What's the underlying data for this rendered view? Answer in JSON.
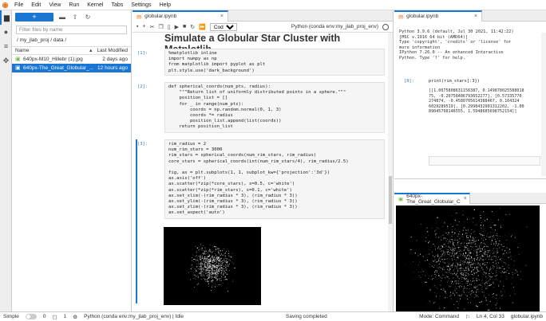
{
  "menubar": {
    "items": [
      "File",
      "Edit",
      "View",
      "Run",
      "Kernel",
      "Tabs",
      "Settings",
      "Help"
    ]
  },
  "leftbar": {
    "icons": [
      "folder-icon",
      "running-icon",
      "commands-icon",
      "extension-icon"
    ]
  },
  "filebrowser": {
    "new_label": "+",
    "filter_placeholder": "Filter files by name",
    "breadcrumb": "/ my_jlab_proj / data /",
    "col_name": "Name",
    "col_modified": "Last Modified",
    "sort_indicator": "▴",
    "files": [
      {
        "name": "640px-M10_Hillebr (1).jpg",
        "modified": "2 days ago"
      },
      {
        "name": "640px-The_Great_Globular_...",
        "modified": "12 hours ago"
      }
    ]
  },
  "notebook": {
    "tab_label": "globular.ipynb",
    "celltype": "Code",
    "kernel": "Python (conda env:my_jlab_proj_env)",
    "title": "Simulate a Globular Star Cluster with Matplotlib",
    "cells": [
      {
        "prompt": "[1]:",
        "code": "%matplotlib inline\nimport numpy as np\nfrom matplotlib import pyplot as plt\nplt.style.use('dark_background')"
      },
      {
        "prompt": "[2]:",
        "code": "def spherical_coords(num_pts, radius):\n    \"\"\"Return list of uniformly distributed points in a sphere.\"\"\"\n    position_list = []\n    for _ in range(num_pts):\n        coords = np.random.normal(0, 1, 3)\n        coords *= radius\n        position_list.append(list(coords))\n    return position_list"
      },
      {
        "prompt": "[3]:",
        "code": "rim_radius = 2\nnum_rim_stars = 3000\nrim_stars = spherical_coords(num_rim_stars, rim_radius)\ncore_stars = spherical_coords(int(num_rim_stars/4), rim_radius/2.5)\n\nfig, ax = plt.subplots(1, 1, subplot_kw={'projection':'3d'})\nax.axis('off')\nax.scatter(*zip(*core_stars), s=0.5, c='white')\nax.scatter(*zip(*rim_stars), s=0.1, c='white')\nax.set_xlim(-(rim_radius * 3), (rim_radius * 3))\nax.set_ylim(-(rim_radius * 3), (rim_radius * 3))\nax.set_zlim(-(rim_radius * 3), (rim_radius * 3))\nax.set_aspect('auto')"
      }
    ]
  },
  "console": {
    "tab_label": "globular.ipynb",
    "banner": "Python 3.9.6 (default, Jul 30 2021, 11:42:22)\n[MSC v.1916 64 bit (AMD64)]\nType 'copyright', 'credits' or 'license' for\nmore information\nIPython 7.26.0 -- An enhanced Interactive\nPython. Type '?' for help.",
    "prompt": "[8]:",
    "input": "print(rim_stars[:3])",
    "output": "[[1.0075808631156387, 0.149878025588018\n75, -0.20758486793652277], [0.57335770\n274874, -0.4580705614388467, 0.164324\n6029289519], [0.2998432901312202, -1.00\n89045798146555, 1.5948685698752154]]"
  },
  "imageviewer": {
    "tab_label": "640px-The_Great_Globular_C"
  },
  "statusbar": {
    "mode_simple": "Simple",
    "count_a": "0",
    "count_b": "1",
    "kernel_status": "Python (conda env:my_jlab_proj_env) | Idle",
    "save_status": "Saving completed",
    "mode": "Mode: Command",
    "position": "Ln 4, Col 33",
    "filename": "globular.ipynb"
  }
}
